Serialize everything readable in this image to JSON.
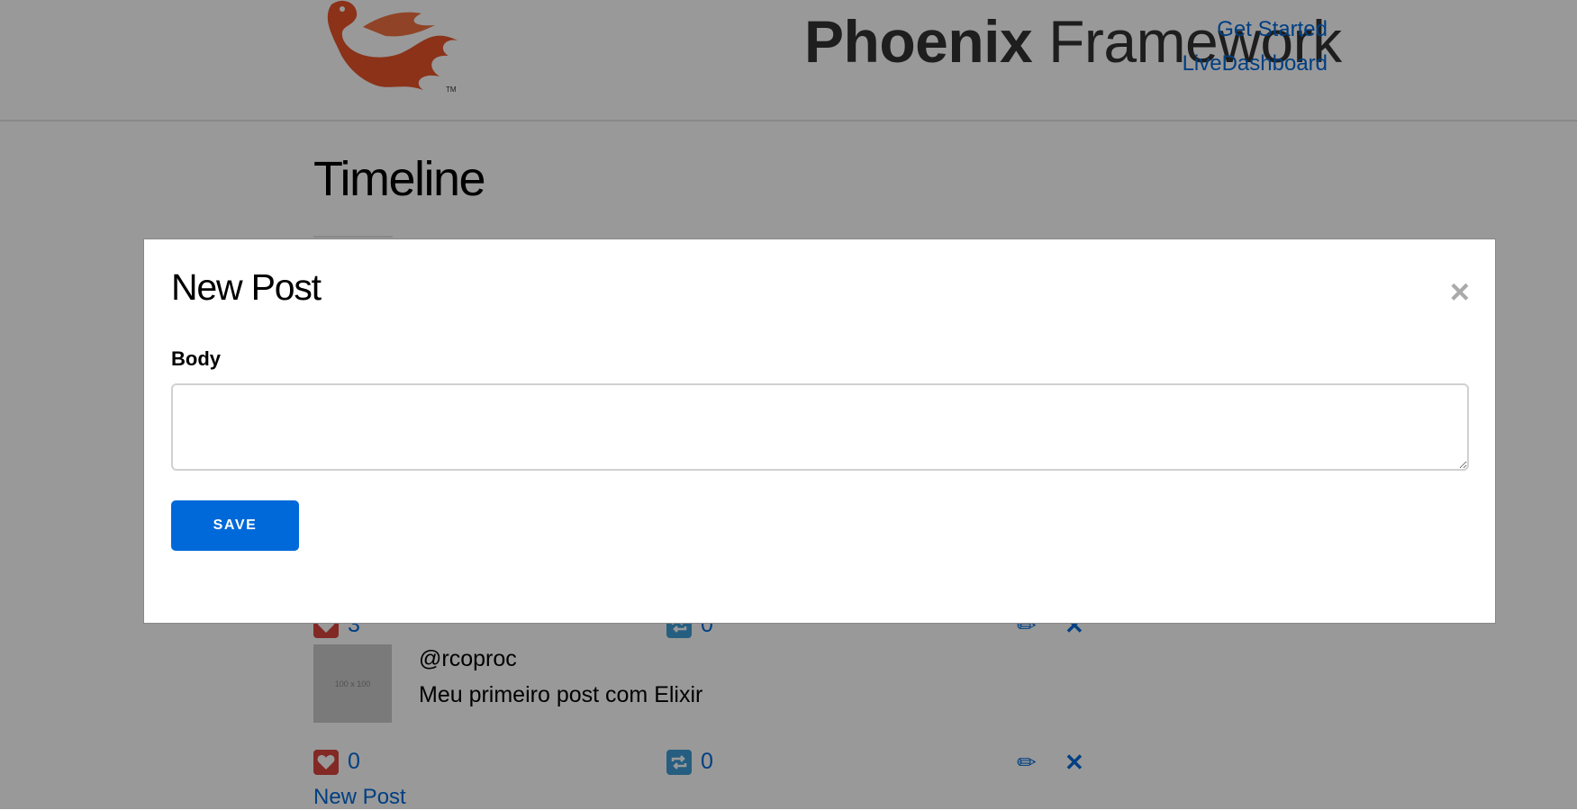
{
  "header": {
    "logo_bold": "Phoenix",
    "logo_light": "Framework",
    "nav": [
      {
        "label": "Get Started"
      },
      {
        "label": "LiveDashboard"
      }
    ]
  },
  "main": {
    "title": "Timeline",
    "posts": [
      {
        "avatar_text": "100 x 100",
        "username": "@rcoproc",
        "body": "Meu primeiro post com Elixir",
        "likes": "0",
        "reposts": "0"
      }
    ],
    "partial_row": {
      "likes": "3",
      "reposts": "0"
    },
    "new_post_link": "New Post",
    "icons": {
      "like": "heart-icon",
      "repost": "repost-icon",
      "edit": "pencil-icon",
      "delete": "x-icon"
    }
  },
  "modal": {
    "title": "New Post",
    "close_label": "×",
    "body_label": "Body",
    "body_value": "",
    "save_label": "SAVE"
  },
  "colors": {
    "link": "#0069d9",
    "logo_orange": "#e8542b",
    "button": "#0069d9",
    "like": "#d9453f",
    "repost": "#3e9dd6"
  }
}
